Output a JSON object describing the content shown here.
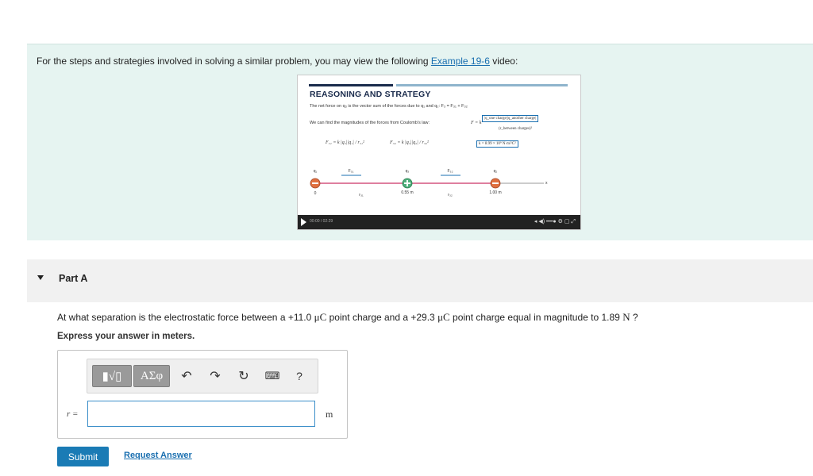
{
  "intro": {
    "text_before": "For the steps and strategies involved in solving a similar problem, you may view the following ",
    "link_text": "Example 19-6",
    "text_after": " video:"
  },
  "video": {
    "title": "REASONING AND STRATEGY",
    "line1": "The net force on q₃ is the vector sum of the forces due to q₁ and q₂:  F₃ = F₃₁ + F₃₂",
    "line2": "We can find the magnitudes of the forces from Coulomb's law:",
    "coulomb_formula": "F = k",
    "coulomb_num": "|q_one charge||q_another charge|",
    "coulomb_den": "(r_between charges)²",
    "k_value": "k = 8.99 × 10⁹ N·m²/C²",
    "f31_formula": "F₃₁ = k |q₃||q₁| / r₃₁²",
    "f32_formula": "F₃₂ = k |q₃||q₂| / r₃₂²",
    "charge_labels": [
      "q₁",
      "q₃",
      "q₂"
    ],
    "force_labels": [
      "F₃₁",
      "F₃₂"
    ],
    "positions": [
      "0",
      "0.55 m",
      "1.00 m"
    ],
    "distance_labels": [
      "r₃₁",
      "r₃₂"
    ],
    "axis_label": "x",
    "time": "00:00 / 02:29"
  },
  "part": {
    "title": "Part A"
  },
  "question": {
    "text1": "At what separation is the electrostatic force between a +11.0 ",
    "unit1": "μC",
    "text2": " point charge and a +29.3 ",
    "unit2": "μC",
    "text3": " point charge equal in magnitude to 1.89 ",
    "unit3": "N",
    "text4": " ?",
    "instruction": "Express your answer in meters."
  },
  "toolbar": {
    "template_label": "▮√▯",
    "symbols_label": "ΑΣφ",
    "help_label": "?"
  },
  "answer": {
    "variable": "r =",
    "value": "",
    "unit": "m"
  },
  "actions": {
    "submit": "Submit",
    "request": "Request Answer"
  }
}
